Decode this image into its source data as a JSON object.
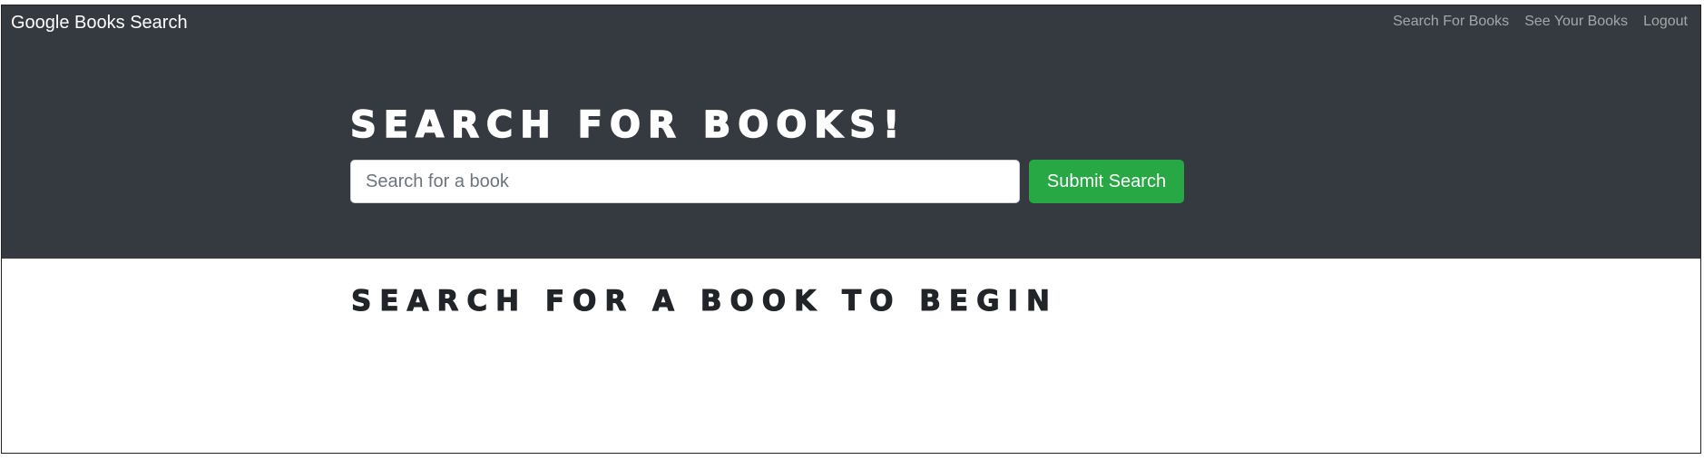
{
  "navbar": {
    "brand": "Google Books Search",
    "links": [
      {
        "label": "Search For Books"
      },
      {
        "label": "See Your Books"
      },
      {
        "label": "Logout"
      }
    ]
  },
  "hero": {
    "title": "Search for Books!",
    "search": {
      "placeholder": "Search for a book",
      "value": ""
    },
    "submit_label": "Submit Search"
  },
  "results": {
    "title": "Search for a book to begin"
  },
  "colors": {
    "navbar_bg": "#343a40",
    "submit_bg": "#28a745"
  }
}
